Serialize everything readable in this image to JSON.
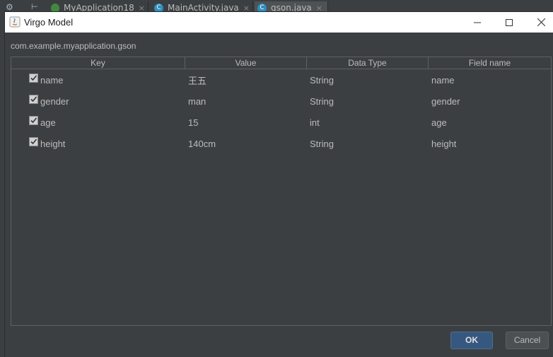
{
  "ide": {
    "tabs": [
      {
        "label": "MyApplication18",
        "icon": "android-icon",
        "active": false
      },
      {
        "label": "MainActivity.java",
        "icon": "class-icon",
        "active": false
      },
      {
        "label": "gson.java",
        "icon": "class-icon",
        "active": true
      }
    ],
    "close_glyph": "×",
    "gear_glyph": "⚙"
  },
  "dialog": {
    "title": "Virgo Model",
    "window_controls": {
      "minimize": "—",
      "maximize": "☐",
      "close": "✕"
    },
    "package": "com.example.myapplication.gson",
    "table": {
      "columns": [
        "Key",
        "Value",
        "Data Type",
        "Field name"
      ],
      "rows": [
        {
          "checked": true,
          "key": "name",
          "value": "王五",
          "type": "String",
          "field": "name"
        },
        {
          "checked": true,
          "key": "gender",
          "value": "man",
          "type": "String",
          "field": "gender"
        },
        {
          "checked": true,
          "key": "age",
          "value": "15",
          "type": "int",
          "field": "age"
        },
        {
          "checked": true,
          "key": "height",
          "value": "140cm",
          "type": "String",
          "field": "height"
        }
      ]
    },
    "buttons": {
      "ok": "OK",
      "cancel": "Cancel"
    }
  },
  "colors": {
    "background": "#3c3f41",
    "ok_button": "#365880",
    "titlebar": "#ffffff"
  }
}
